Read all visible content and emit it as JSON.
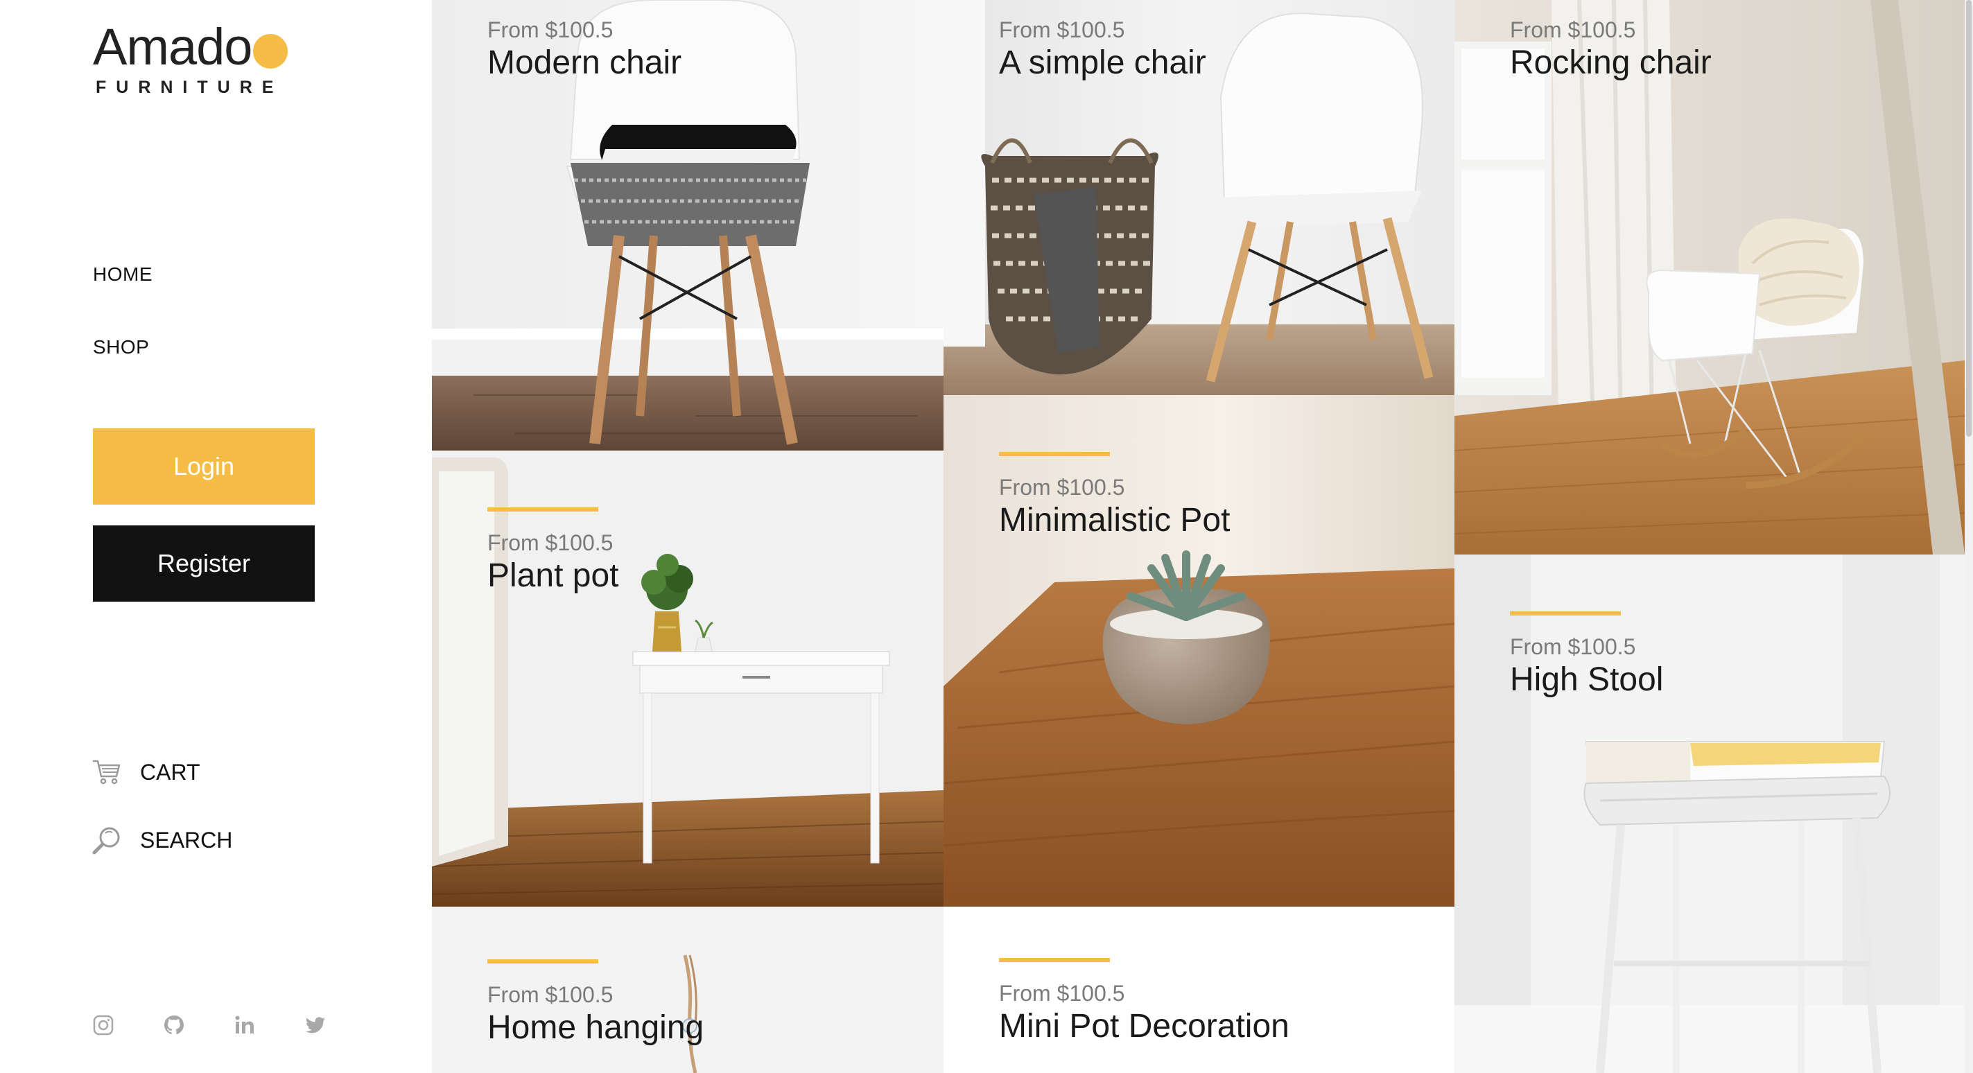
{
  "brand": {
    "name": "Amado",
    "subtitle": "FURNITURE",
    "accent_color": "#f5bd45"
  },
  "nav": {
    "home": "HOME",
    "shop": "SHOP"
  },
  "buttons": {
    "login": "Login",
    "register": "Register",
    "login_color": "#f5bd45",
    "register_color": "#131212"
  },
  "utilities": {
    "cart": "CART",
    "search": "SEARCH",
    "cart_icon": "cart-icon",
    "search_icon": "search-icon"
  },
  "social": [
    "instagram-icon",
    "github-icon",
    "linkedin-icon",
    "twitter-icon"
  ],
  "products": [
    {
      "price": "From $100.5",
      "name": "Modern chair"
    },
    {
      "price": "From $100.5",
      "name": "A simple chair"
    },
    {
      "price": "From $100.5",
      "name": "Rocking chair"
    },
    {
      "price": "From $100.5",
      "name": "Plant pot"
    },
    {
      "price": "From $100.5",
      "name": "Minimalistic Pot"
    },
    {
      "price": "From $100.5",
      "name": "High Stool"
    },
    {
      "price": "From $100.5",
      "name": "Home hanging"
    },
    {
      "price": "From $100.5",
      "name": "Mini Pot Decoration"
    }
  ]
}
